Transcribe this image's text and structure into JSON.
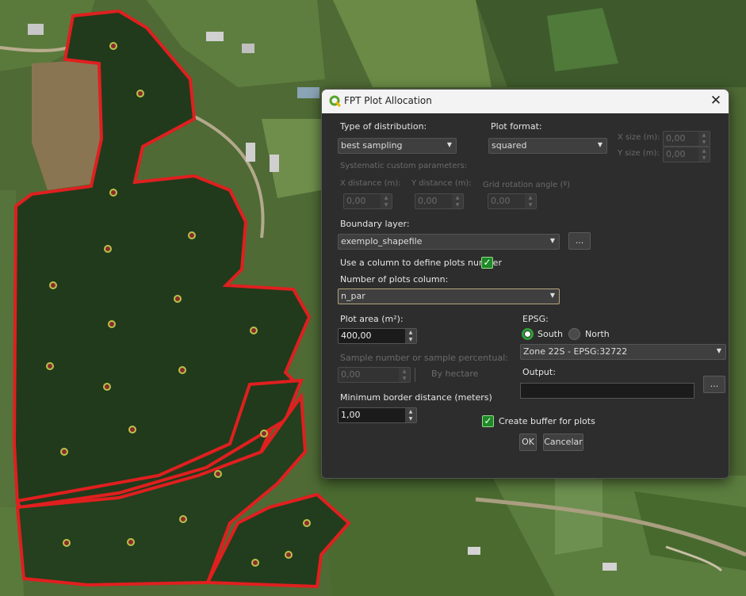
{
  "window": {
    "title": "FPT Plot Allocation",
    "close_label": "✕"
  },
  "distribution": {
    "label": "Type of distribution:",
    "value": "best sampling"
  },
  "plot_format": {
    "label": "Plot format:",
    "value": "squared"
  },
  "x_size": {
    "label": "X size (m):",
    "value": "0,00"
  },
  "y_size": {
    "label": "Y size (m):",
    "value": "0,00"
  },
  "systematic": {
    "label": "Systematic custom parameters:",
    "x_distance_label": "X distance (m):",
    "x_distance_value": "0,00",
    "y_distance_label": "Y distance (m):",
    "y_distance_value": "0,00",
    "rotation_label": "Grid rotation angle (º)",
    "rotation_value": "0,00"
  },
  "boundary": {
    "label": "Boundary layer:",
    "value": "exemplo_shapefile",
    "browse_label": "..."
  },
  "use_column": {
    "label": "Use a column to define plots number",
    "checked": true
  },
  "plots_column": {
    "label": "Number of plots column:",
    "value": "n_par"
  },
  "plot_area": {
    "label": "Plot area (m²):",
    "value": "400,00"
  },
  "epsg": {
    "label": "EPSG:",
    "south_label": "South",
    "north_label": "North",
    "selected": "South",
    "zone_value": "Zone 22S - EPSG:32722"
  },
  "sample": {
    "label": "Sample number or sample percentual:",
    "value": "0,00",
    "by_hectare_label": "By hectare"
  },
  "output": {
    "label": "Output:",
    "value": "",
    "browse_label": "..."
  },
  "min_border": {
    "label": "Minimum border distance (meters)",
    "value": "1,00"
  },
  "buffer": {
    "label": "Create buffer for plots",
    "checked": true
  },
  "buttons": {
    "ok_label": "OK",
    "cancel_label": "Cancelar"
  },
  "colors": {
    "boundary": "#e01f1f",
    "plot_point": "#b8c24a",
    "dialog_bg": "#2d2d2d",
    "checkbox": "#1c8a26",
    "radio": "#2fa037"
  }
}
